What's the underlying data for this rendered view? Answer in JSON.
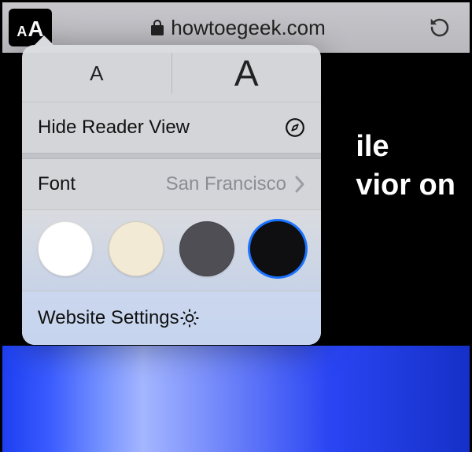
{
  "address_bar": {
    "aa_small": "A",
    "aa_big": "A",
    "url": "howtoegeek.com"
  },
  "popover": {
    "smaller_label": "A",
    "larger_label": "A",
    "reader_label": "Hide Reader View",
    "font_label": "Font",
    "font_value": "San Francisco",
    "colors": [
      {
        "name": "white",
        "hex": "#ffffff",
        "selected": false
      },
      {
        "name": "sepia",
        "hex": "#f3ead5",
        "selected": false
      },
      {
        "name": "gray",
        "hex": "#4e4e54",
        "selected": false
      },
      {
        "name": "black",
        "hex": "#0f0f12",
        "selected": true
      }
    ],
    "settings_label": "Website Settings"
  },
  "page": {
    "title_line1": "ile",
    "title_line2": "vior on"
  }
}
